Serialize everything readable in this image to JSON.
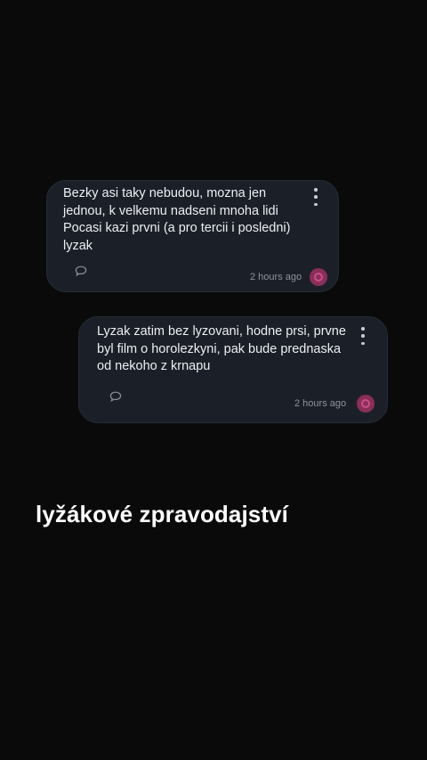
{
  "messages": [
    {
      "text": "Bezky asi taky nebudou, mozna jen jednou, k velkemu nadseni mnoha lidi\nPocasi kazi prvni (a pro tercii i posledni) lyzak",
      "time": "2 hours ago",
      "icons": {
        "menu": "more-vertical-icon",
        "comment": "comment-bubble-icon",
        "avatar": "user-avatar"
      }
    },
    {
      "text": "Lyzak zatim bez lyzovani, hodne prsi, prvne byl film o horolezkyni, pak bude prednaska od nekoho z krnapu",
      "time": "2 hours ago",
      "icons": {
        "menu": "more-vertical-icon",
        "comment": "comment-bubble-icon",
        "avatar": "user-avatar"
      }
    }
  ],
  "headline": "lyžákové zpravodajství",
  "colors": {
    "background": "#0a0a0b",
    "card": "#1b2028",
    "text": "#eceef2",
    "muted": "#8d939c",
    "avatar": "#8a2f5a"
  }
}
